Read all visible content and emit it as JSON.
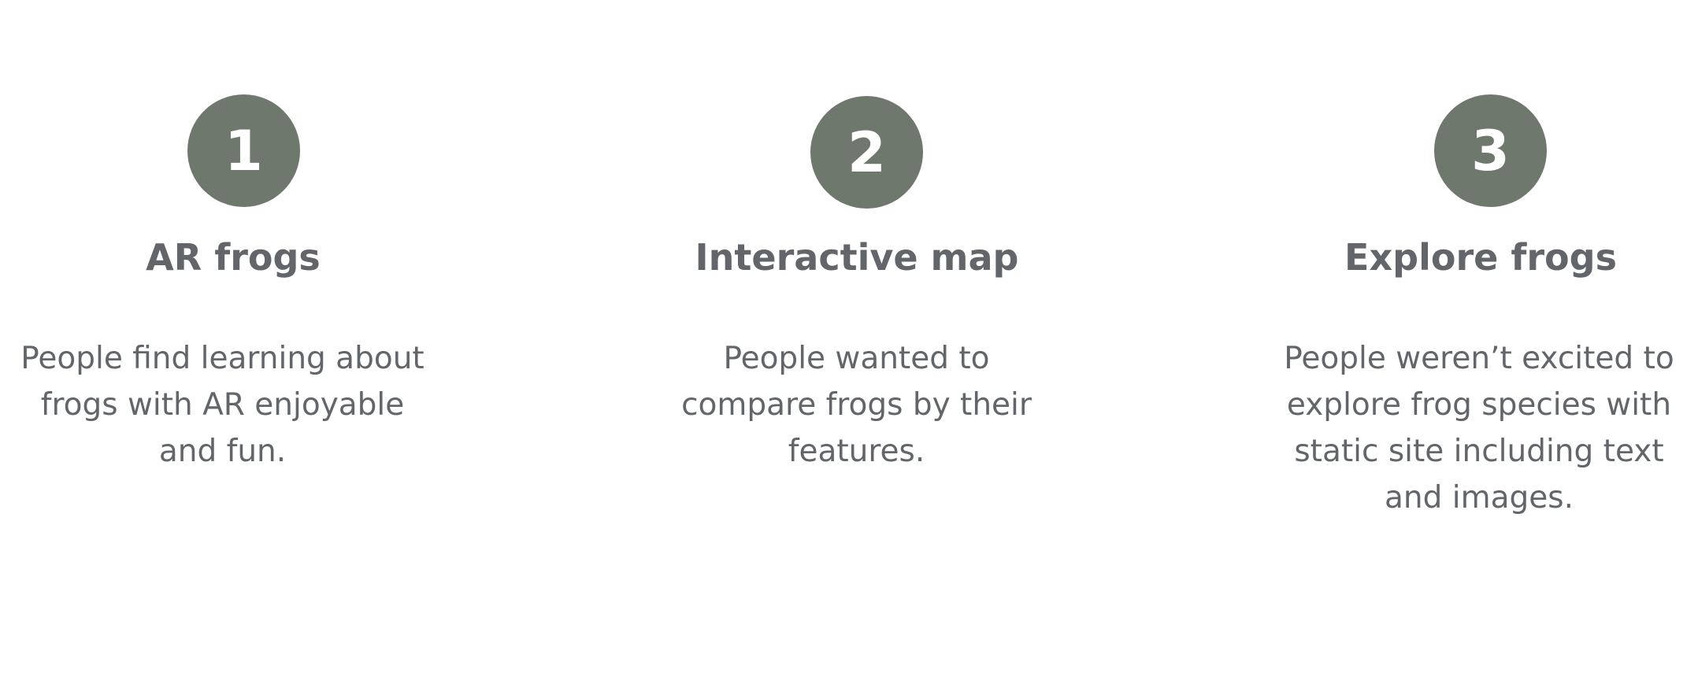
{
  "theme": {
    "badge_color": "#6e786c",
    "text_color": "#62666a",
    "background": "#ffffff"
  },
  "steps": [
    {
      "number": "1",
      "title": "AR frogs",
      "lines": [
        "People find learning about",
        "frogs with AR enjoyable",
        "and fun."
      ]
    },
    {
      "number": "2",
      "title": "Interactive map",
      "lines": [
        "People wanted to",
        "compare frogs by their",
        "features."
      ]
    },
    {
      "number": "3",
      "title": "Explore frogs",
      "lines": [
        "People weren’t excited  to",
        "explore frog species with",
        "static site including text",
        "and images."
      ]
    }
  ]
}
